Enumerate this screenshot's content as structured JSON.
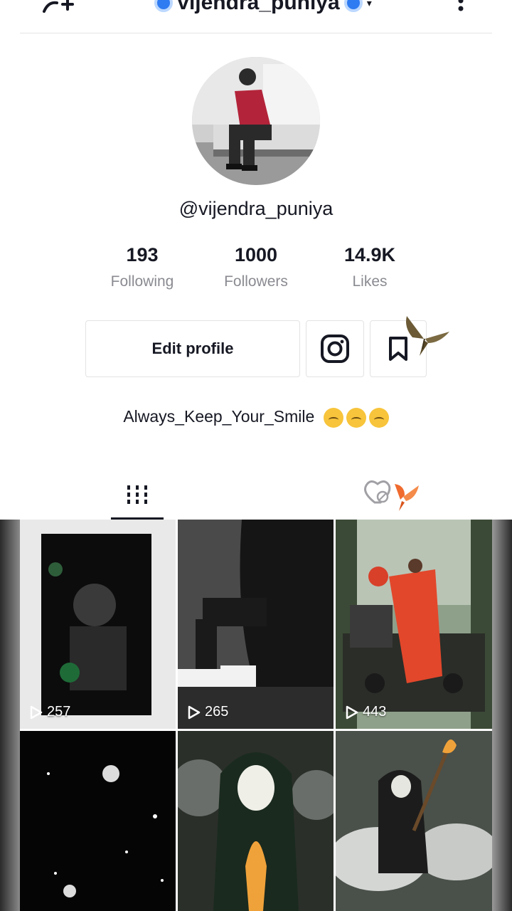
{
  "header": {
    "title": "vijendra_puniya",
    "add_user_icon": "person-add-icon",
    "more_icon": "vertical-dots-icon",
    "caret_icon": "chevron-down-icon"
  },
  "profile": {
    "avatar_icon": "profile-photo",
    "username": "@vijendra_puniya",
    "stats": [
      {
        "value": "193",
        "label": "Following"
      },
      {
        "value": "1000",
        "label": "Followers"
      },
      {
        "value": "14.9K",
        "label": "Likes"
      }
    ],
    "edit_profile_label": "Edit profile",
    "instagram_icon": "instagram-icon",
    "bookmark_icon": "bookmark-icon",
    "bio": "Always_Keep_Your_Smile"
  },
  "tabs": {
    "videos_icon": "grid-icon",
    "liked_icon": "liked-private-icon"
  },
  "videos": [
    {
      "views": "257"
    },
    {
      "views": "265"
    },
    {
      "views": "443"
    },
    {
      "views": ""
    },
    {
      "views": ""
    },
    {
      "views": ""
    }
  ],
  "colors": {
    "text": "#161823",
    "muted": "#8a8b91",
    "border": "#e3e3e4",
    "badge": "#2f7bf1"
  }
}
